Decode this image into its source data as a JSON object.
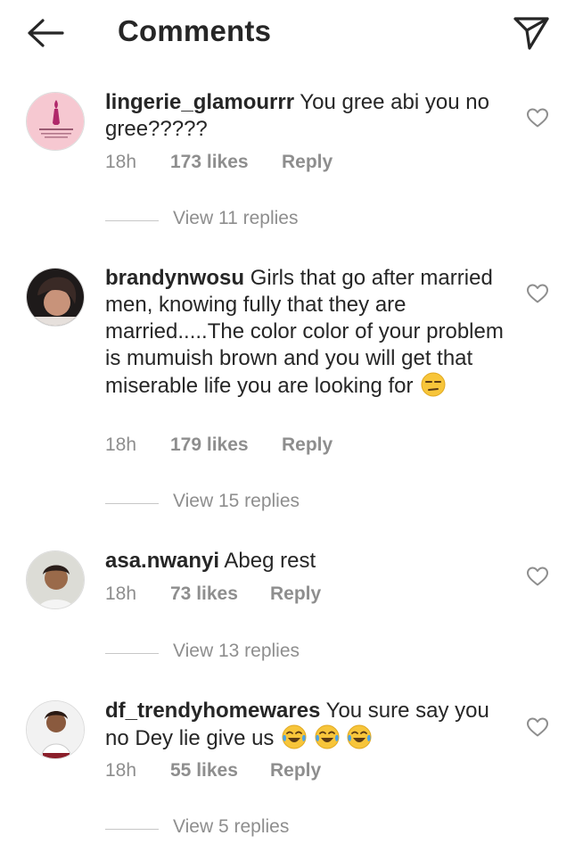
{
  "header": {
    "title": "Comments",
    "back_icon": "arrow-left-icon",
    "share_icon": "paper-plane-icon"
  },
  "colors": {
    "text": "#262626",
    "muted": "#8e8e8e",
    "divider": "#c7c7c7"
  },
  "comments": [
    {
      "username": "lingerie_glamourrr",
      "text": "You gree abi you no gree?????",
      "time": "18h",
      "likes": "173 likes",
      "reply": "Reply",
      "view_replies": "View 11 replies"
    },
    {
      "username": "brandynwosu",
      "text": "Girls that go after married men, knowing fully that they are married.....The color color of your problem is mumuish brown and you will get that miserable life you are looking for",
      "emoji": "unamused-face-emoji",
      "time": "18h",
      "likes": "179 likes",
      "reply": "Reply",
      "view_replies": "View 15 replies"
    },
    {
      "username": "asa.nwanyi",
      "text": "Abeg rest",
      "time": "18h",
      "likes": "73 likes",
      "reply": "Reply",
      "view_replies": "View 13 replies"
    },
    {
      "username": "df_trendyhomewares",
      "text": "You sure say you no Dey lie give us",
      "emoji": "tears-of-joy-emoji",
      "time": "18h",
      "likes": "55 likes",
      "reply": "Reply",
      "view_replies": "View 5 replies"
    }
  ]
}
